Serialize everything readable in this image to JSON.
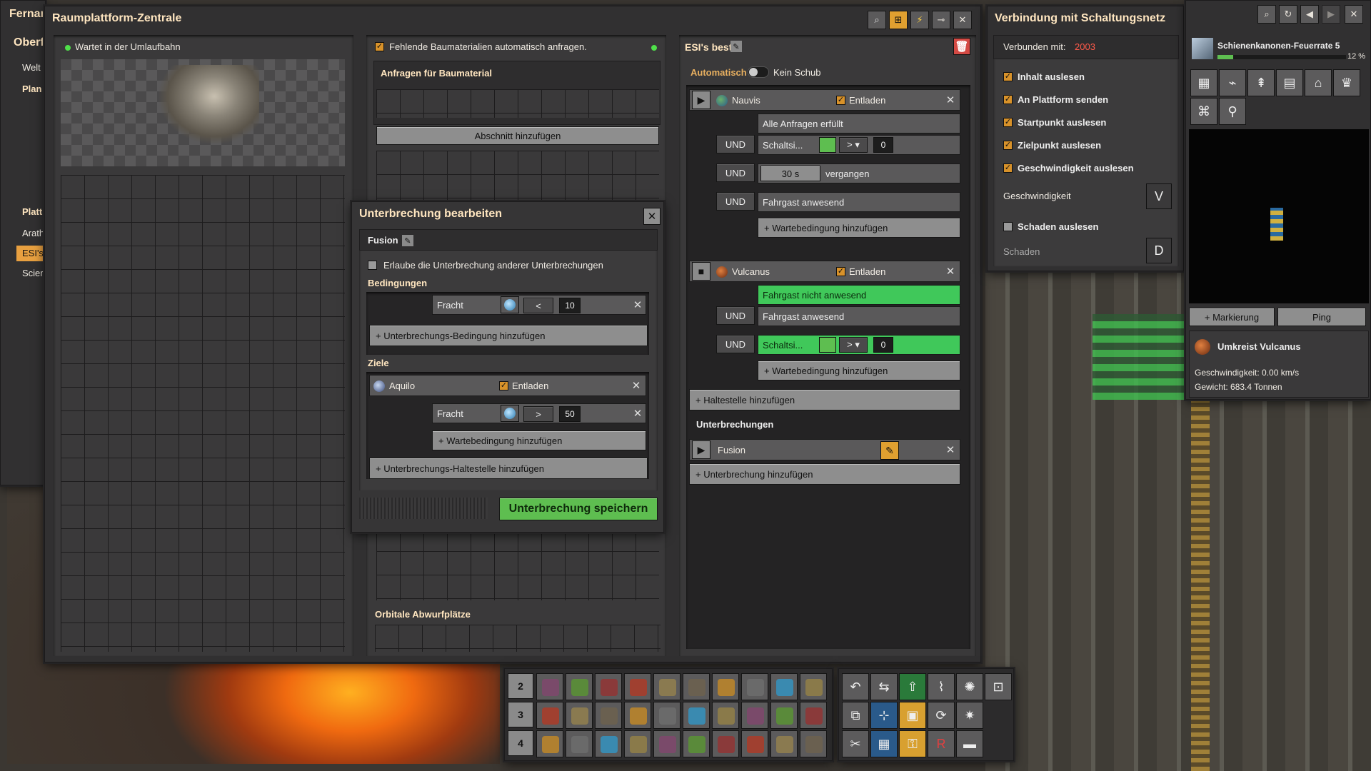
{
  "left_stub": {
    "title": "Fernan",
    "subtitle": "Oberf",
    "items": [
      "Welt",
      "Plan",
      "Platt",
      "Arath",
      "ESI's",
      "Scier"
    ]
  },
  "platform": {
    "title": "Raumplattform-Zentrale",
    "status": "Wartet in der Umlaufbahn",
    "auto_request": "Fehlende Baumaterialien automatisch anfragen.",
    "requests_header": "Anfragen für Baumaterial",
    "add_section": "Abschnitt hinzufügen",
    "orbital_drop": "Orbitale Abwurfplätze"
  },
  "schedule": {
    "name": "ESI's best",
    "auto_label": "Automatisch",
    "push_label": "Kein Schub",
    "stop1": {
      "name": "Nauvis",
      "unload": "Entladen"
    },
    "stop1_conds": [
      "Alle Anfragen erfüllt",
      "Schaltsi...",
      "vergangen",
      "Fahrgast anwesend"
    ],
    "stop1_val": "0",
    "time": "30 s",
    "and": "UND",
    "add_wait": "+ Wartebedingung hinzufügen",
    "stop2": {
      "name": "Vulcanus",
      "unload": "Entladen"
    },
    "stop2_conds": [
      "Fahrgast nicht anwesend",
      "Fahrgast anwesend",
      "Schaltsi..."
    ],
    "stop2_val": "0",
    "add_stop": "+ Haltestelle hinzufügen",
    "interrupts_header": "Unterbrechungen",
    "interrupt_name": "Fusion",
    "add_interrupt": "+ Unterbrechung hinzufügen"
  },
  "interrupt_dialog": {
    "title": "Unterbrechung bearbeiten",
    "name": "Fusion",
    "allow_label": "Erlaube die Unterbrechung anderer Unterbrechungen",
    "conditions_label": "Bedingungen",
    "cargo": "Fracht",
    "op_lt": "<",
    "val1": "10",
    "add_condition": "+ Unterbrechungs-Bedingung hinzufügen",
    "targets_label": "Ziele",
    "target_name": "Aquilo",
    "unload": "Entladen",
    "op_gt": ">",
    "val2": "50",
    "add_wait": "+ Wartebedingung hinzufügen",
    "add_stop": "+ Unterbrechungs-Haltestelle hinzufügen",
    "save": "Unterbrechung speichern"
  },
  "circuit": {
    "title": "Verbindung mit Schaltungsnetz",
    "connected_label": "Verbunden mit:",
    "connected_value": "2003",
    "options": [
      "Inhalt auslesen",
      "An Plattform senden",
      "Startpunkt auslesen",
      "Zielpunkt auslesen",
      "Geschwindigkeit auslesen"
    ],
    "speed_label": "Geschwindigkeit",
    "speed_signal": "V",
    "damage_check": "Schaden auslesen",
    "damage_label": "Schaden",
    "damage_signal": "D"
  },
  "minimap": {
    "research": "Schienenkanonen-Feuerrate 5",
    "research_pct": "12 %",
    "research_progress": 0.12,
    "marker_btn": "+ Markierung",
    "ping_btn": "Ping",
    "orbit_title": "Umkreist Vulcanus",
    "speed_line": "Geschwindigkeit: 0.00 km/s",
    "weight_line": "Gewicht: 683.4 Tonnen"
  },
  "toolbar": {
    "rows": [
      "2",
      "3",
      "4"
    ]
  }
}
